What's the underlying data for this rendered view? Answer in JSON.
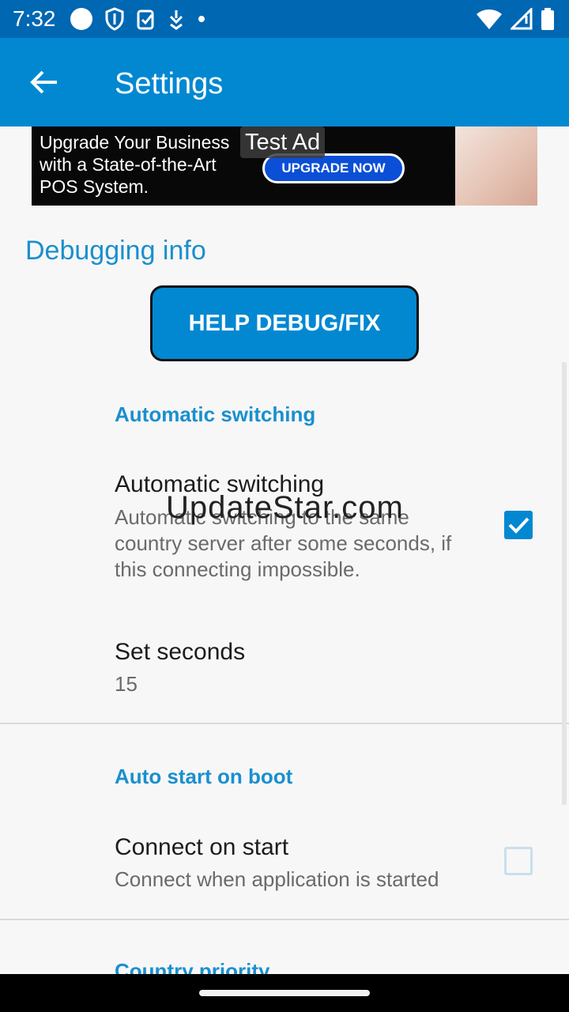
{
  "status_bar": {
    "time": "7:32",
    "left_icons": [
      "circle-icon",
      "shield-icon",
      "clipboard-check-icon",
      "download-icon",
      "dot-icon"
    ],
    "right_icons": [
      "wifi-icon",
      "signal-icon",
      "battery-icon"
    ]
  },
  "app_bar": {
    "title": "Settings",
    "back_icon": "arrow-left-icon",
    "color": "#0288d1"
  },
  "ad": {
    "text": "Upgrade Your Business with a State-of-the-Art POS System.",
    "cta": "UPGRADE NOW",
    "badge": "Test Ad"
  },
  "debug": {
    "header": "Debugging info",
    "button_label": "HELP DEBUG/FIX"
  },
  "preferences": {
    "auto_switch_category": "Automatic switching",
    "auto_switch_title": "Automatic switching",
    "auto_switch_summary": "Automatic switching to the same country server after some seconds, if this connecting impossible.",
    "auto_switch_checked": true,
    "set_seconds_title": "Set seconds",
    "set_seconds_value": "15",
    "boot_category": "Auto start on boot",
    "connect_title": "Connect on start",
    "connect_summary": "Connect when application is started",
    "connect_checked": false,
    "country_category": "Country priority"
  },
  "watermark": "UpdateStar.com",
  "colors": {
    "accent": "#1a8fcf",
    "status_bar": "#0067b3",
    "background": "#f7f7f7"
  }
}
